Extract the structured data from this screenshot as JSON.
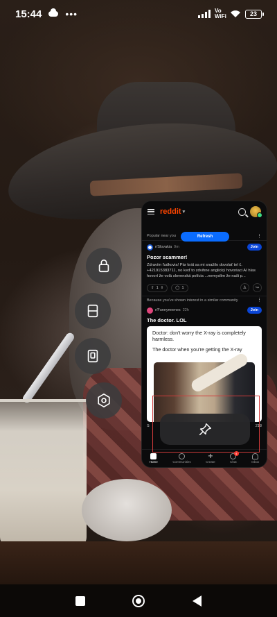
{
  "status_bar": {
    "time": "15:44",
    "network_label": "Vo WiFi",
    "battery": "23"
  },
  "floating_toolbar": {
    "buttons": [
      {
        "name": "lock",
        "icon": "lock-icon"
      },
      {
        "name": "split-screen",
        "icon": "split-screen-icon"
      },
      {
        "name": "floating-window",
        "icon": "floating-window-icon"
      },
      {
        "name": "settings",
        "icon": "hexagon-settings-icon"
      }
    ]
  },
  "reddit": {
    "logo": "reddit",
    "refresh_label": "Refresh",
    "section_label": "Popular near you",
    "posts": [
      {
        "subreddit": "r/Slovakia",
        "time": "9m",
        "join_label": "Join",
        "title": "Pozor scammer!",
        "body": "Zdravím ľudkovia! Pár krát sa mi snažilo dovolať tel č. +421915383711, no keď to zdvihne anglický hovoriaci AI hlas hovorí že volá slovenská polícia ...nemyslím že naši p...",
        "upvotes": "1",
        "comments": "1"
      },
      {
        "interest_label": "Because you've shown interest in a similar community",
        "subreddit": "r/Funnymemes",
        "time": "22h",
        "join_label": "Join",
        "title": "The doctor. LOL",
        "meme_line_1": "Doctor: don't worry the X-ray is completely harmless.",
        "meme_line_2": "The doctor when you're getting the X-ray",
        "upvotes_short": "S",
        "shares": "218"
      }
    ],
    "bottom_nav": [
      {
        "label": "Home",
        "active": true
      },
      {
        "label": "Communities"
      },
      {
        "label": "Create"
      },
      {
        "label": "Chat",
        "badge": "4"
      },
      {
        "label": "Inbox"
      }
    ]
  },
  "pin_overlay": {
    "icon": "pin-icon"
  },
  "system_nav": {
    "recents": "square-icon",
    "home": "circle-icon",
    "back": "triangle-back-icon"
  },
  "colors": {
    "reddit_orange": "#ff4500",
    "refresh_blue": "#0a6cff",
    "join_blue": "#0a45d6",
    "pin_outline": "#d23b3b"
  }
}
